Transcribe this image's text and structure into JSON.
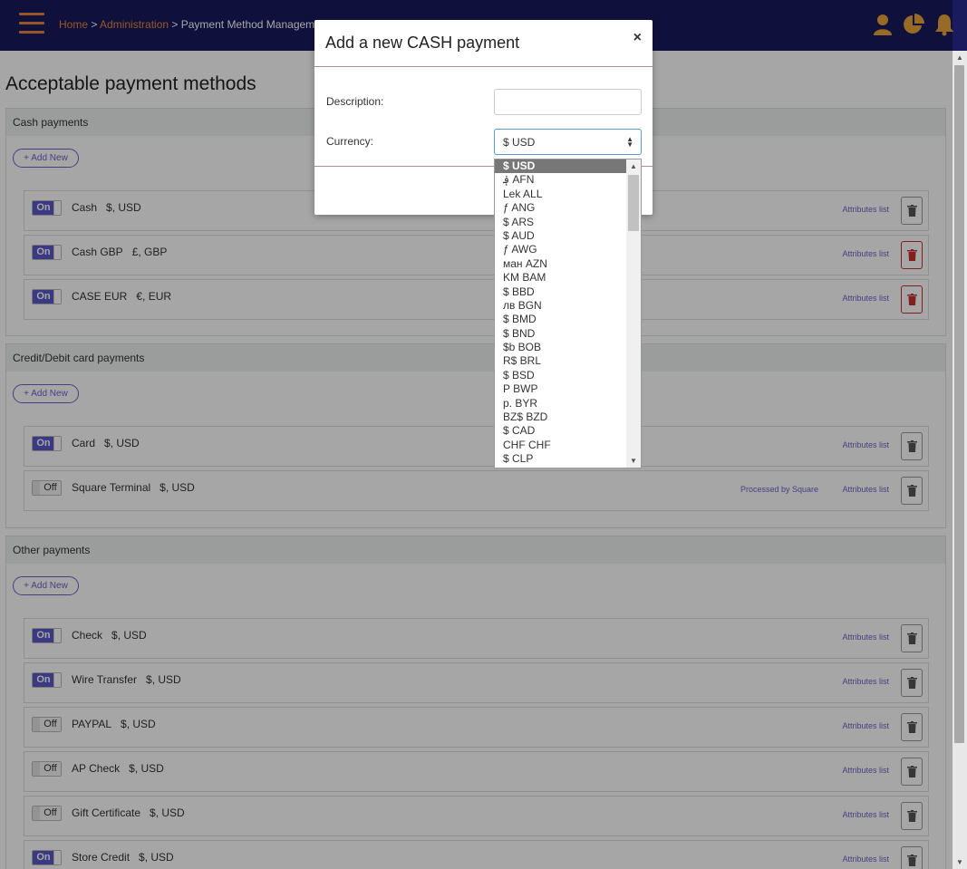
{
  "nav": {
    "breadcrumb": {
      "home": "Home",
      "sep1": " > ",
      "admin": "Administration",
      "sep2": " > ",
      "current": "Payment Method Manageme"
    }
  },
  "page": {
    "title": "Acceptable payment methods",
    "add_new_label": "+ Add New",
    "attributes_label": "Attributes list",
    "square_label": "Processed by Square"
  },
  "sections": [
    {
      "title": "Cash payments",
      "rows": [
        {
          "state": "On",
          "name": "Cash",
          "currency": "$, USD",
          "delete_red": false
        },
        {
          "state": "On",
          "name": "Cash GBP",
          "currency": "£, GBP",
          "delete_red": true
        },
        {
          "state": "On",
          "name": "CASE EUR",
          "currency": "€, EUR",
          "delete_red": true
        }
      ]
    },
    {
      "title": "Credit/Debit card payments",
      "rows": [
        {
          "state": "On",
          "name": "Card",
          "currency": "$, USD",
          "delete_red": false
        },
        {
          "state": "Off",
          "name": "Square Terminal",
          "currency": "$, USD",
          "delete_red": false,
          "square": true
        }
      ]
    },
    {
      "title": "Other payments",
      "rows": [
        {
          "state": "On",
          "name": "Check",
          "currency": "$, USD",
          "delete_red": false
        },
        {
          "state": "On",
          "name": "Wire Transfer",
          "currency": "$, USD",
          "delete_red": false
        },
        {
          "state": "Off",
          "name": "PAYPAL",
          "currency": "$, USD",
          "delete_red": false
        },
        {
          "state": "Off",
          "name": "AP Check",
          "currency": "$, USD",
          "delete_red": false
        },
        {
          "state": "Off",
          "name": "Gift Certificate",
          "currency": "$, USD",
          "delete_red": false
        },
        {
          "state": "On",
          "name": "Store Credit",
          "currency": "$, USD",
          "delete_red": false
        }
      ]
    }
  ],
  "modal": {
    "title": "Add a new CASH payment",
    "close": "×",
    "description_label": "Description:",
    "description_value": "",
    "currency_label": "Currency:",
    "currency_value": "$ USD"
  },
  "currency_options": [
    "$ USD",
    "؋ AFN",
    "Lek ALL",
    "ƒ ANG",
    "$ ARS",
    "$ AUD",
    "ƒ AWG",
    "ман AZN",
    "KM BAM",
    "$ BBD",
    "лв BGN",
    "$ BMD",
    "$ BND",
    "$b BOB",
    "R$ BRL",
    "$ BSD",
    "P BWP",
    "p. BYR",
    "BZ$ BZD",
    "$ CAD",
    "CHF CHF",
    "$ CLP"
  ],
  "colors": {
    "navbar": "#1a1a5e",
    "accent_orange": "#e8843a",
    "toggle_on": "#5b58c7",
    "link_purple": "#6c63c7",
    "delete_red": "#c83232"
  }
}
